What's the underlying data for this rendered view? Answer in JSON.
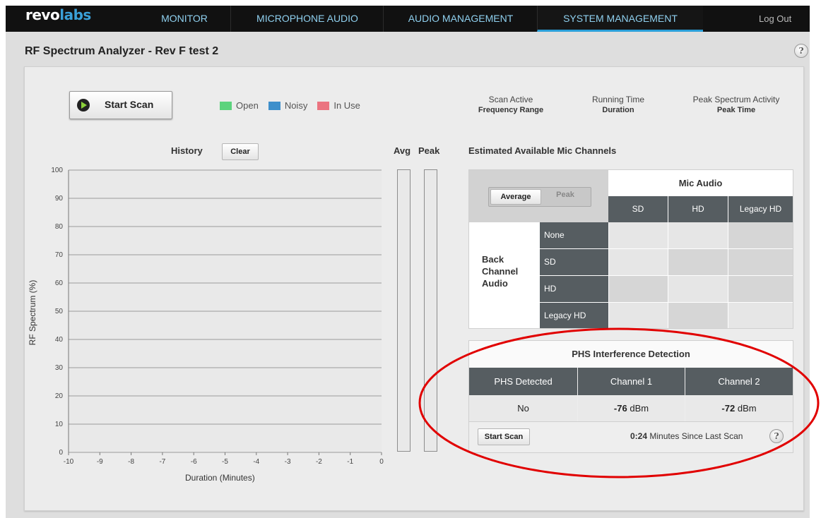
{
  "nav": {
    "logo_a": "revo",
    "logo_b": "labs",
    "items": [
      "MONITOR",
      "MICROPHONE AUDIO",
      "AUDIO MANAGEMENT",
      "SYSTEM MANAGEMENT"
    ],
    "active": "SYSTEM MANAGEMENT",
    "logout": "Log Out"
  },
  "page": {
    "title": "RF Spectrum Analyzer - Rev F test 2",
    "help": "?"
  },
  "scan": {
    "start_label": "Start Scan",
    "legend": [
      {
        "label": "Open",
        "color": "#5cd37d"
      },
      {
        "label": "Noisy",
        "color": "#3e8fcb"
      },
      {
        "label": "In Use",
        "color": "#eb7480"
      }
    ],
    "headers": [
      {
        "top": "Scan Active",
        "bottom": "Frequency Range"
      },
      {
        "top": "Running Time",
        "bottom": "Duration"
      },
      {
        "top": "Peak Spectrum Activity",
        "bottom": "Peak Time"
      }
    ]
  },
  "history": {
    "title": "History",
    "clear_label": "Clear",
    "avg_label": "Avg",
    "peak_label": "Peak",
    "ylabel": "RF Spectrum (%)",
    "xlabel": "Duration (Minutes)",
    "yticks": [
      "100",
      "90",
      "80",
      "70",
      "60",
      "50",
      "40",
      "30",
      "20",
      "10",
      "0"
    ],
    "xticks": [
      "-10",
      "-9",
      "-8",
      "-7",
      "-6",
      "-5",
      "-4",
      "-3",
      "-2",
      "-1",
      "0"
    ]
  },
  "mic": {
    "title": "Estimated Available Mic Channels",
    "toggle_average": "Average",
    "toggle_peak": "Peak",
    "mic_audio": "Mic Audio",
    "cols": [
      "SD",
      "HD",
      "Legacy HD"
    ],
    "back_channel": "Back Channel Audio",
    "rows": [
      "None",
      "SD",
      "HD",
      "Legacy HD"
    ]
  },
  "phs": {
    "title": "PHS Interference Detection",
    "cols": [
      "PHS Detected",
      "Channel 1",
      "Channel 2"
    ],
    "detected": "No",
    "ch1_value": "-76",
    "ch2_value": "-72",
    "unit": "dBm",
    "start_label": "Start Scan",
    "elapsed": "0:24",
    "elapsed_label": "Minutes Since Last Scan",
    "help": "?"
  }
}
